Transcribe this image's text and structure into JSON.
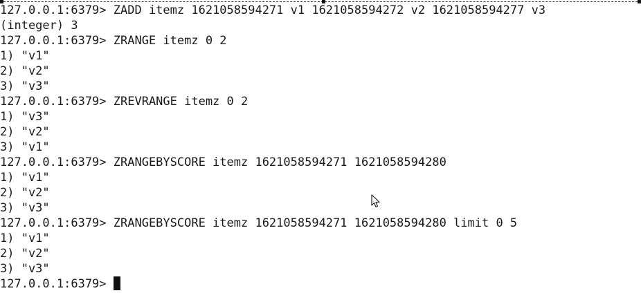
{
  "terminal": {
    "prompt": "127.0.0.1:6379> ",
    "lines": [
      {
        "type": "command",
        "text": "ZADD itemz 1621058594271 v1 1621058594272 v2 1621058594277 v3"
      },
      {
        "type": "output",
        "text": "(integer) 3"
      },
      {
        "type": "command",
        "text": "ZRANGE itemz 0 2"
      },
      {
        "type": "output",
        "text": "1) \"v1\""
      },
      {
        "type": "output",
        "text": "2) \"v2\""
      },
      {
        "type": "output",
        "text": "3) \"v3\""
      },
      {
        "type": "command",
        "text": "ZREVRANGE itemz 0 2"
      },
      {
        "type": "output",
        "text": "1) \"v3\""
      },
      {
        "type": "output",
        "text": "2) \"v2\""
      },
      {
        "type": "output",
        "text": "3) \"v1\""
      },
      {
        "type": "command",
        "text": "ZRANGEBYSCORE itemz 1621058594271 1621058594280"
      },
      {
        "type": "output",
        "text": "1) \"v1\""
      },
      {
        "type": "output",
        "text": "2) \"v2\""
      },
      {
        "type": "output",
        "text": "3) \"v3\""
      },
      {
        "type": "command",
        "text": "ZRANGEBYSCORE itemz 1621058594271 1621058594280 limit 0 5"
      },
      {
        "type": "output",
        "text": "1) \"v1\""
      },
      {
        "type": "output",
        "text": "2) \"v2\""
      },
      {
        "type": "output",
        "text": "3) \"v3\""
      },
      {
        "type": "input",
        "text": ""
      }
    ]
  },
  "icons": {
    "cursor": "text-cursor-block",
    "pointer": "mouse-pointer-icon"
  },
  "colors": {
    "background": "#ffffff",
    "text": "#1a1a1a",
    "cursor": "#111111"
  }
}
